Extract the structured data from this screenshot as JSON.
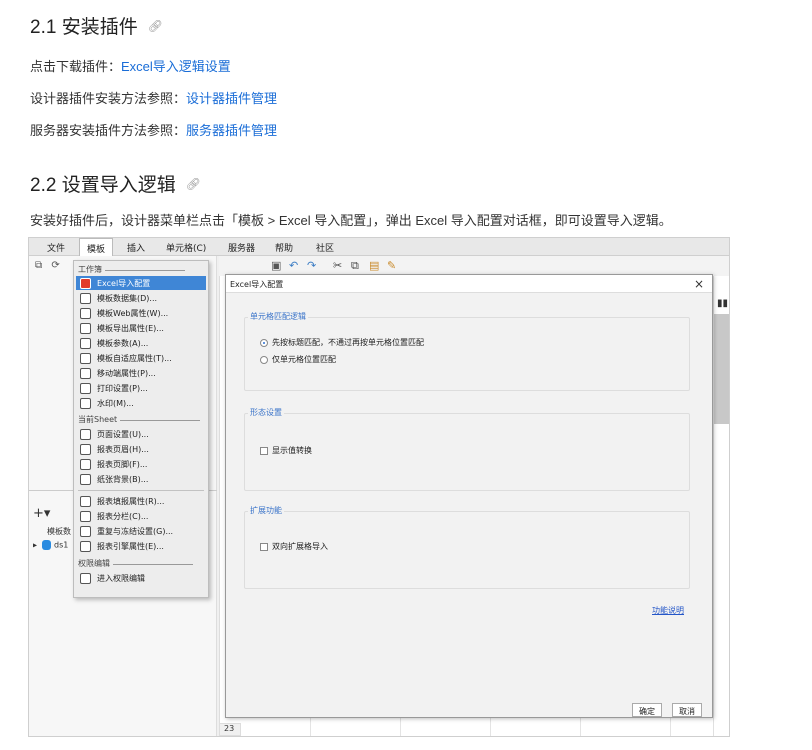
{
  "doc": {
    "section1_title": "2.1 安装插件",
    "line1_prefix": "点击下载插件：",
    "line1_link": "Excel导入逻辑设置",
    "line2_prefix": "设计器插件安装方法参照：",
    "line2_link": "设计器插件管理",
    "line3_prefix": "服务器安装插件方法参照：",
    "line3_link": "服务器插件管理",
    "section2_title": "2.2 设置导入逻辑",
    "instruction": "安装好插件后，设计器菜单栏点击「模板 > Excel 导入配置」，弹出 Excel 导入配置对话框，即可设置导入逻辑。",
    "anchor_icon": "link-icon"
  },
  "app": {
    "menubar": [
      "文件",
      "模板",
      "插入",
      "单元格(C)",
      "服务器",
      "帮助",
      "社区"
    ],
    "left_panel_label": "模板数",
    "datasource_label": "ds1",
    "row_number": "23"
  },
  "dropdown": {
    "group1_header": "工作簿",
    "group1_items": [
      "Excel导入配置",
      "模板数据集(D)...",
      "模板Web属性(W)...",
      "模板导出属性(E)...",
      "模板参数(A)...",
      "模板自适应属性(T)...",
      "移动端属性(P)...",
      "打印设置(P)...",
      "水印(M)..."
    ],
    "group2_header": "当前Sheet",
    "group2_items": [
      "页面设置(U)...",
      "报表页眉(H)...",
      "报表页脚(F)...",
      "纸张背景(B)..."
    ],
    "group3_items": [
      "报表填报属性(R)...",
      "报表分栏(C)...",
      "重复与冻结设置(G)...",
      "报表引擎属性(E)..."
    ],
    "group4_header": "权限编辑",
    "group4_items": [
      "进入权限编辑"
    ]
  },
  "dialog": {
    "title": "Excel导入配置",
    "close": "×",
    "group1_title": "单元格匹配逻辑",
    "radio1": "先按标题匹配，不通过再按单元格位置匹配",
    "radio2": "仅单元格位置匹配",
    "radio1_selected": true,
    "group2_title": "形态设置",
    "checkbox1": "显示值转换",
    "group3_title": "扩展功能",
    "checkbox2": "双向扩展格导入",
    "help_link": "功能说明",
    "ok": "确定",
    "cancel": "取消"
  },
  "colors": {
    "link": "#1a6dd7",
    "highlight": "#3f86d6",
    "group_title": "#3b74c9"
  }
}
